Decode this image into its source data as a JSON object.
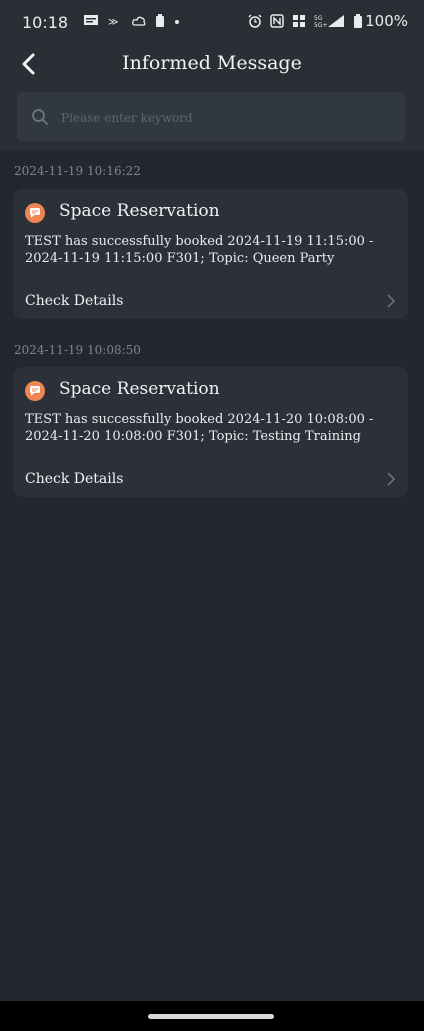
{
  "status_bar": {
    "time": "10:18",
    "battery": "100%",
    "left_icons": [
      "message-icon",
      "sim-icon",
      "cloud-icon",
      "battery-small-icon",
      "dot-icon"
    ],
    "right_icons": [
      "alarm-icon",
      "nfc-icon",
      "signal-hd-icon",
      "5g-signal-icon",
      "battery-icon"
    ]
  },
  "header": {
    "title": "Informed Message",
    "back_icon": "chevron-left-icon"
  },
  "search": {
    "placeholder": "Please enter keyword",
    "value": ""
  },
  "messages": [
    {
      "timestamp": "2024-11-19 10:16:22",
      "title": "Space Reservation",
      "body": "TEST has successfully booked 2024-11-19 11:15:00 - 2024-11-19 11:15:00 F301; Topic: Queen Party",
      "link": "Check Details"
    },
    {
      "timestamp": "2024-11-19 10:08:50",
      "title": "Space Reservation",
      "body": "TEST has successfully booked 2024-11-20 10:08:00 - 2024-11-20 10:08:00 F301; Topic: Testing Training",
      "link": "Check Details"
    }
  ],
  "colors": {
    "background": "#23272e",
    "header": "#2a2f36",
    "card": "#2c3139",
    "accent": "#ef8652"
  }
}
